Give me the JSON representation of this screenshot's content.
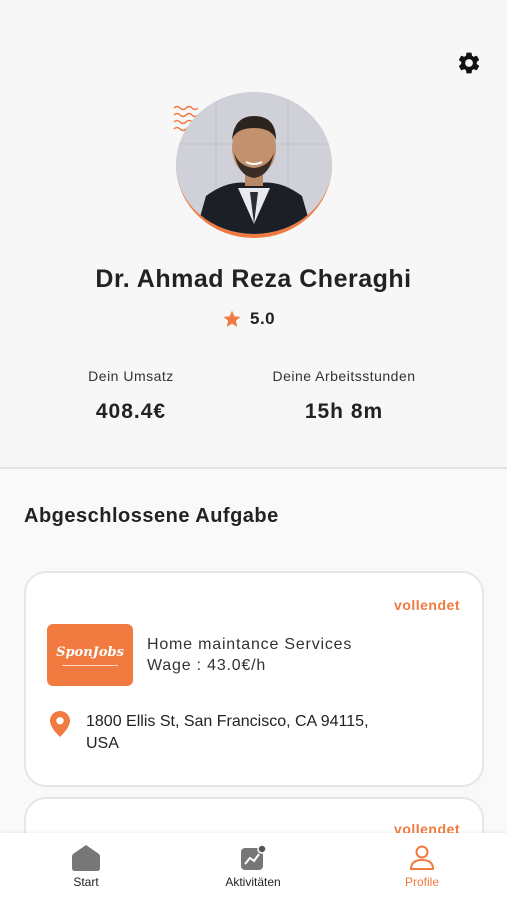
{
  "colors": {
    "accent": "#f07a3f",
    "background": "#f7f7f7",
    "card": "#ffffff",
    "text": "#1f1f1f"
  },
  "header": {
    "settings_icon": "gear-icon"
  },
  "profile": {
    "name": "Dr. Ahmad Reza Cheraghi",
    "rating": "5.0",
    "rating_icon": "star-icon",
    "stats": [
      {
        "label": "Dein Umsatz",
        "value": "408.4€"
      },
      {
        "label": "Deine Arbeitsstunden",
        "value": "15h 8m"
      }
    ]
  },
  "completed": {
    "title": "Abgeschlossene Aufgabe",
    "tasks": [
      {
        "status": "vollendet",
        "company_logo_text": "SponJobs",
        "title": "Home maintance Services",
        "wage": "Wage : 43.0€/h",
        "address": "1800 Ellis St, San Francisco, CA 94115, USA",
        "location_icon": "location-pin-icon"
      },
      {
        "status": "vollendet"
      }
    ]
  },
  "tabbar": {
    "items": [
      {
        "label": "Start",
        "icon": "home-icon",
        "active": false
      },
      {
        "label": "Aktivitäten",
        "icon": "activity-chart-icon",
        "active": false
      },
      {
        "label": "Profile",
        "icon": "user-icon",
        "active": true
      }
    ]
  }
}
